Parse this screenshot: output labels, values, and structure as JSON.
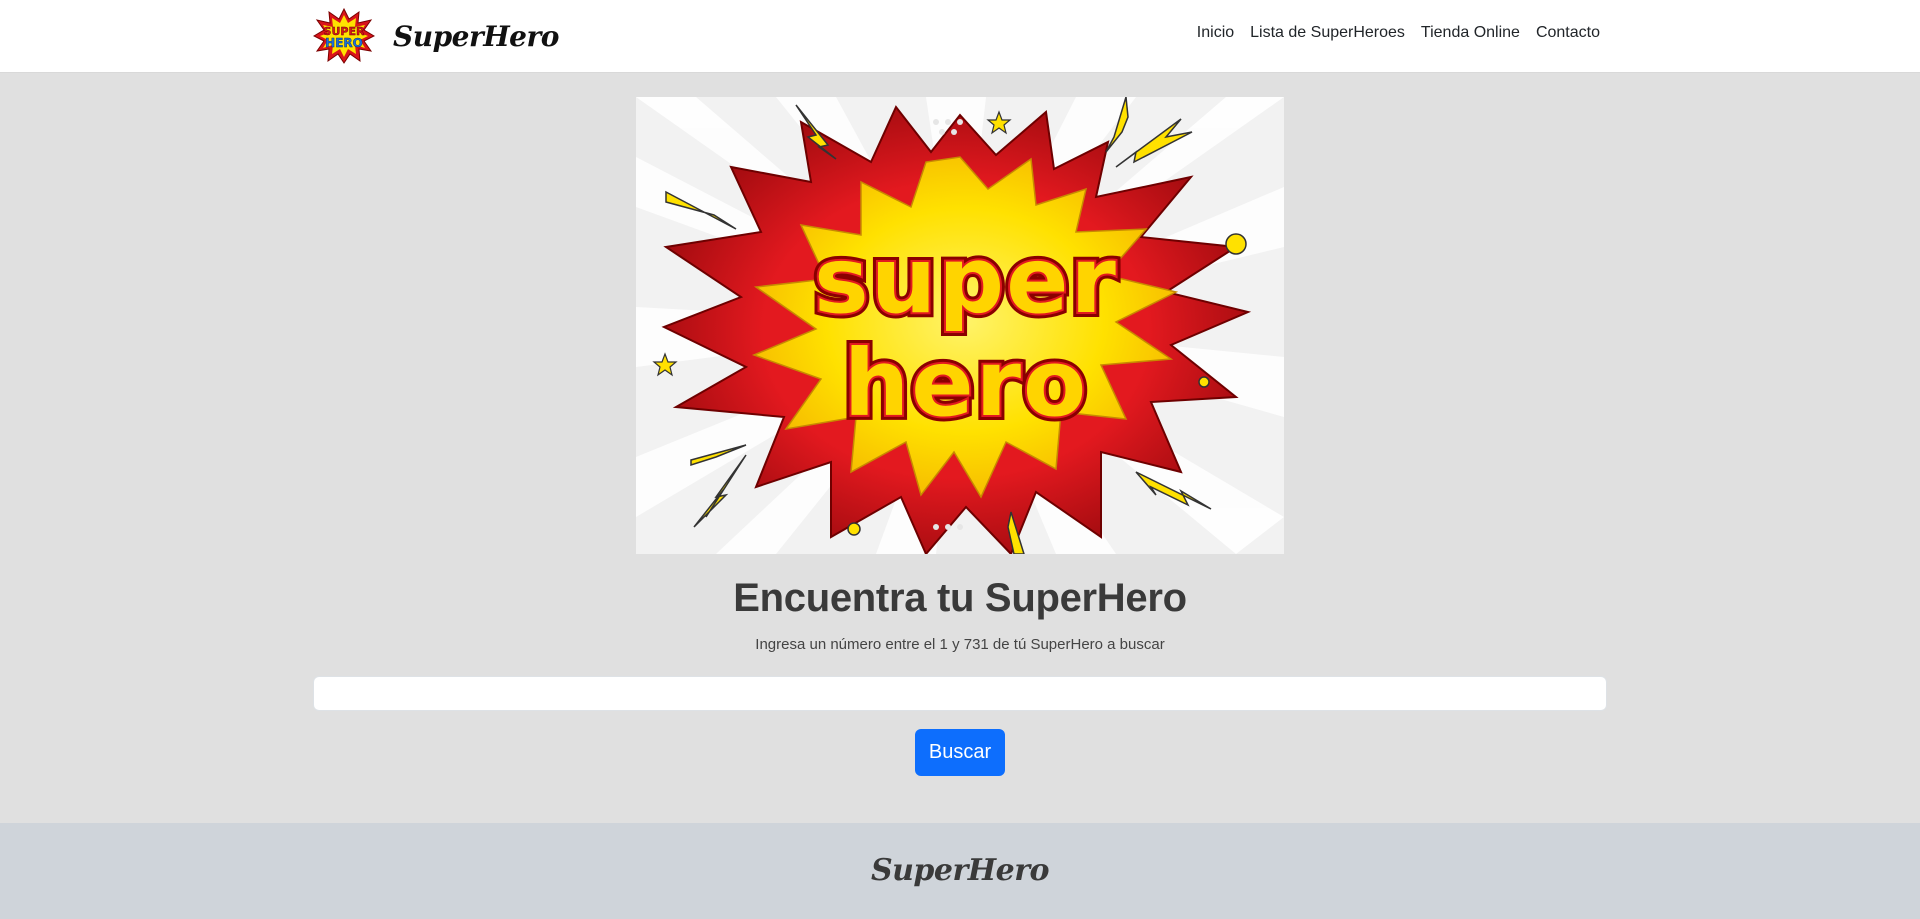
{
  "navbar": {
    "brand_name": "SuperHero",
    "logo_text_top": "SUPER",
    "logo_text_bottom": "HERO",
    "links": [
      {
        "label": "Inicio"
      },
      {
        "label": "Lista de SuperHeroes"
      },
      {
        "label": "Tienda Online"
      },
      {
        "label": "Contacto"
      }
    ]
  },
  "hero": {
    "image_text_line1": "super",
    "image_text_line2": "hero"
  },
  "search": {
    "title": "Encuentra tu SuperHero",
    "subtitle": "Ingresa un número entre el 1 y 731 de tú SuperHero a buscar",
    "input_value": "",
    "placeholder": "",
    "button_label": "Buscar"
  },
  "footer": {
    "brand_name": "SuperHero"
  },
  "colors": {
    "primary": "#0d6efd",
    "page_bg": "#e0e0e0",
    "footer_bg": "#cfd4da",
    "comic_yellow": "#ffe100",
    "comic_red": "#d9141a"
  }
}
